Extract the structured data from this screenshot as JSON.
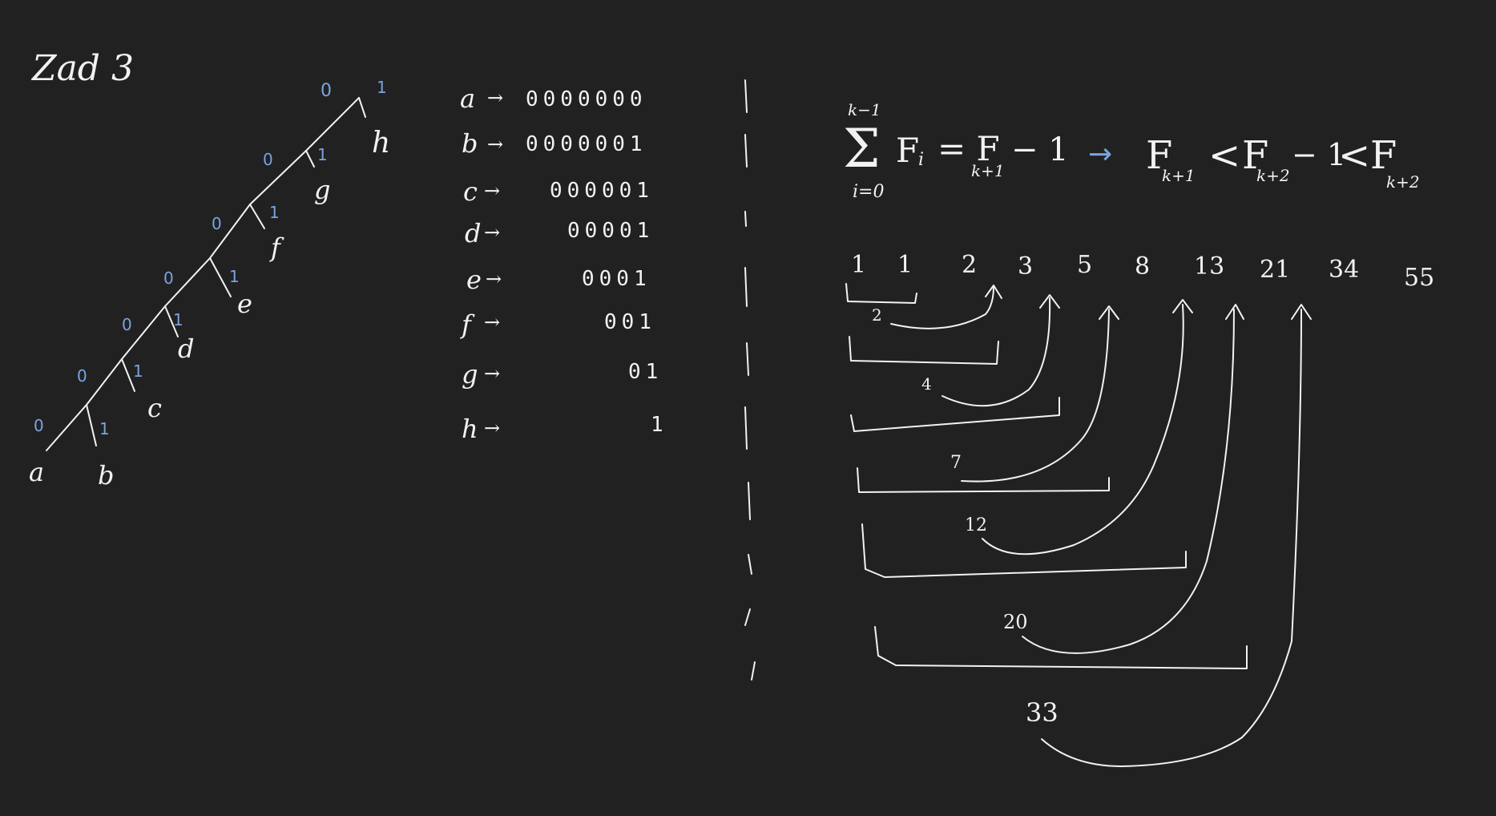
{
  "note": {
    "title": "Zad 3"
  },
  "tree": {
    "edge_zero": "0",
    "edge_one": "1",
    "leaves": [
      "a",
      "b",
      "c",
      "d",
      "e",
      "f",
      "g",
      "h"
    ]
  },
  "codes": [
    {
      "letter": "a",
      "arrow": "→",
      "code": "0000000"
    },
    {
      "letter": "b",
      "arrow": "→",
      "code": "0000001"
    },
    {
      "letter": "c",
      "arrow": "→",
      "code": "000001"
    },
    {
      "letter": "d",
      "arrow": "→",
      "code": "00001"
    },
    {
      "letter": "e",
      "arrow": "→",
      "code": "0001"
    },
    {
      "letter": "f",
      "arrow": "→",
      "code": "001"
    },
    {
      "letter": "g",
      "arrow": "→",
      "code": "01"
    },
    {
      "letter": "h",
      "arrow": "→",
      "code": "1"
    }
  ],
  "formula": {
    "sum_upper": "k−1",
    "sum_symbol": "Σ",
    "sum_lower": "i=0",
    "term": "F",
    "term_sub": "i",
    "equals_lhs": "= F",
    "equals_sub": "k+1",
    "minus_one": "− 1",
    "implies": "→",
    "ineq_f1": "F",
    "ineq_f1_sub": "k+1",
    "lt1": "<",
    "ineq_f2": "F",
    "ineq_f2_sub": "k+2",
    "ineq_minus": "− 1",
    "lt2": "<",
    "ineq_f3": "F",
    "ineq_f3_sub": "k+2"
  },
  "fibonacci": [
    "1",
    "1",
    "2",
    "3",
    "5",
    "8",
    "13",
    "21",
    "34",
    "55"
  ],
  "partial_sums": [
    "2",
    "4",
    "7",
    "12",
    "20",
    "33"
  ]
}
